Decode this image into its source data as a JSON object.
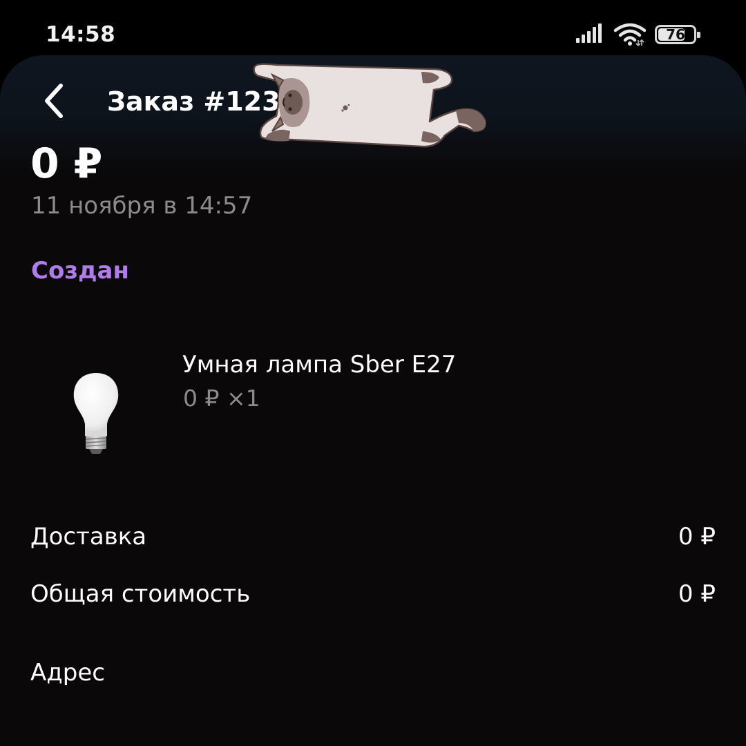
{
  "status_bar": {
    "time": "14:58",
    "battery_level": "76",
    "battery_fraction": 0.76,
    "icons": [
      "signal-icon",
      "wifi-icon",
      "battery-icon"
    ]
  },
  "header": {
    "title": "Заказ #123",
    "back_icon": "chevron-left-icon",
    "sticker": "cat-sticker"
  },
  "order": {
    "total": "0 ₽",
    "date": "11 ноября в 14:57",
    "status": "Создан",
    "status_color": "#b07bea"
  },
  "items": [
    {
      "name": "Умная лампа Sber E27",
      "price_qty": "0 ₽ ×1",
      "image": "light-bulb-image"
    }
  ],
  "summary": {
    "delivery_label": "Доставка",
    "delivery_value": "0 ₽",
    "total_label": "Общая стоимость",
    "total_value": "0 ₽"
  },
  "address": {
    "heading": "Адрес"
  }
}
